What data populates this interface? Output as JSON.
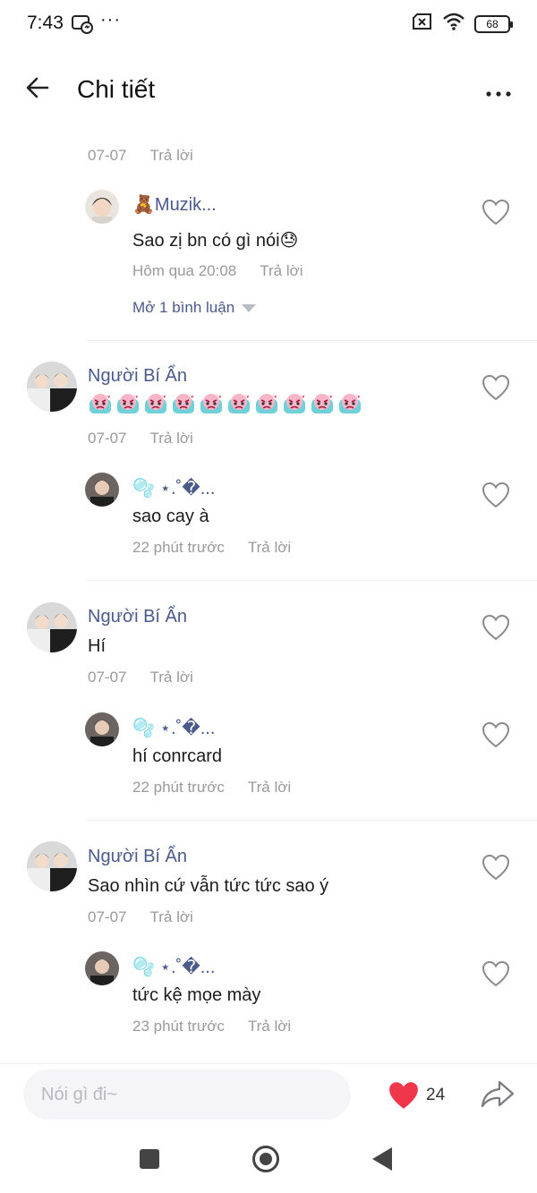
{
  "status": {
    "time": "7:43",
    "dots": "···",
    "battery": "68"
  },
  "header": {
    "title": "Chi tiết"
  },
  "top_meta": {
    "date": "07-07",
    "reply": "Trả lời"
  },
  "reply_muzik": {
    "name": "🧸Muzik...",
    "text": "Sao zị bn có gì nói😓",
    "time": "Hôm qua 20:08",
    "reply": "Trả lời",
    "expand": "Mở 1 bình luận"
  },
  "comments": [
    {
      "name": "Người Bí Ẩn",
      "text": "",
      "emoji_count": 10,
      "date": "07-07",
      "reply": "Trả lời",
      "sub": {
        "name": "🫧 ⋆.˚�...",
        "text": "sao cay à",
        "time": "22 phút trước",
        "reply": "Trả lời"
      }
    },
    {
      "name": "Người Bí Ẩn",
      "text": "Hí",
      "date": "07-07",
      "reply": "Trả lời",
      "sub": {
        "name": "🫧 ⋆.˚�...",
        "text": "hí conrcard",
        "time": "22 phút trước",
        "reply": "Trả lời"
      }
    },
    {
      "name": "Người Bí Ẩn",
      "text": "Sao nhìn cứ vẫn tức tức sao ý",
      "date": "07-07",
      "reply": "Trả lời",
      "sub": {
        "name": "🫧 ⋆.˚�...",
        "text": "tức kệ mọe mày",
        "time": "23 phút trước",
        "reply": "Trả lời"
      }
    }
  ],
  "bottom": {
    "placeholder": "Nói gì đi~",
    "likes": "24"
  },
  "colors": {
    "name": "#4a5a8a",
    "meta": "#9a9a9a",
    "heart_fill": "#f0364a"
  }
}
